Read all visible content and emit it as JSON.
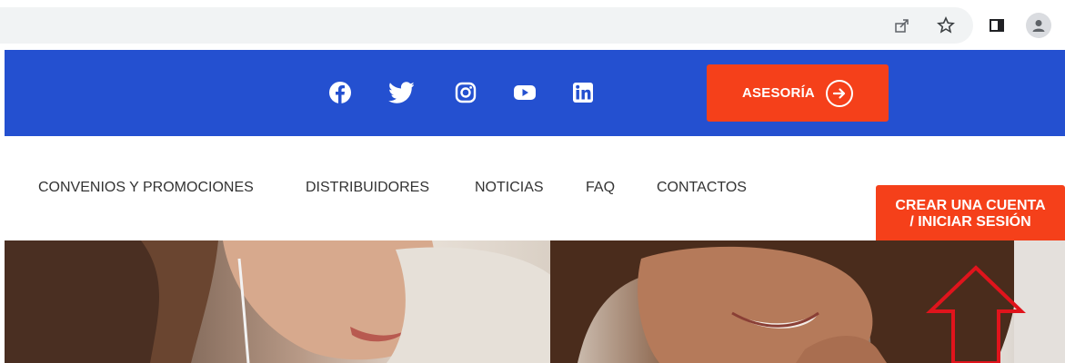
{
  "browser": {
    "icons": [
      "share-icon",
      "bookmark-star-icon",
      "side-panel-icon",
      "profile-icon"
    ]
  },
  "topbar": {
    "social": [
      "facebook-icon",
      "twitter-icon",
      "instagram-icon",
      "youtube-icon",
      "linkedin-icon"
    ],
    "asesoria_label": "ASESORÍA",
    "accent_color": "#f5401a",
    "bar_color": "#2450d0"
  },
  "nav": {
    "items": [
      "CONVENIOS Y PROMOCIONES",
      "DISTRIBUIDORES",
      "NOTICIAS",
      "FAQ",
      "CONTACTOS"
    ],
    "cta_line1": "CREAR UNA CUENTA",
    "cta_line2": "/ INICIAR SESIÓN"
  },
  "hero": {
    "annotation": "red-arrow-pointing-up"
  }
}
